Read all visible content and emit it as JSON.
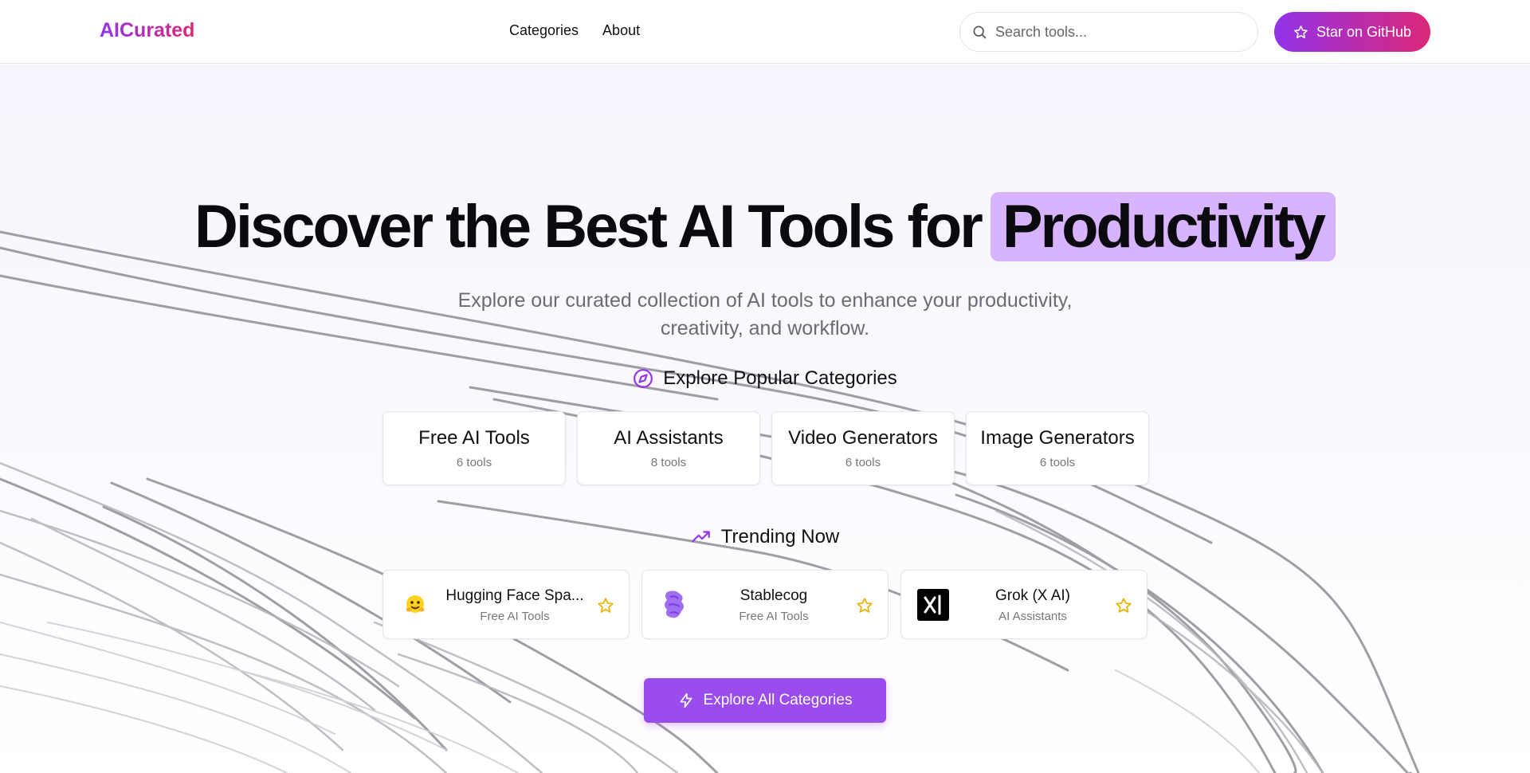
{
  "brand": {
    "logo_text": "AICurated",
    "gradient_from": "#9333ea",
    "gradient_to": "#db2777"
  },
  "nav": {
    "items": [
      {
        "label": "Categories"
      },
      {
        "label": "About"
      }
    ]
  },
  "search": {
    "placeholder": "Search tools...",
    "value": "",
    "icon": "search-icon"
  },
  "github_button": {
    "label": "Star on GitHub",
    "icon": "star-icon"
  },
  "hero": {
    "title": "Discover the Best AI Tools for",
    "highlight": "Productivity",
    "highlight_color": "#d8b4fe",
    "subtitle_line1": "Explore our curated collection of AI tools to enhance your productivity,",
    "subtitle_line2": "creativity, and workflow."
  },
  "categories_section": {
    "heading": "Explore Popular Categories",
    "icon": "compass-icon",
    "items": [
      {
        "name": "Free AI Tools",
        "count": "6 tools"
      },
      {
        "name": "AI Assistants",
        "count": "8 tools"
      },
      {
        "name": "Video Generators",
        "count": "6 tools"
      },
      {
        "name": "Image Generators",
        "count": "6 tools"
      }
    ]
  },
  "trending_section": {
    "heading": "Trending Now",
    "icon": "trending-up-icon",
    "items": [
      {
        "name": "Hugging Face Spa...",
        "category": "Free AI Tools",
        "logo": "hugging-face-logo"
      },
      {
        "name": "Stablecog",
        "category": "Free AI Tools",
        "logo": "stablecog-logo"
      },
      {
        "name": "Grok (X AI)",
        "category": "AI Assistants",
        "logo": "grok-logo"
      }
    ]
  },
  "explore_button": {
    "label": "Explore All Categories",
    "icon": "lightning-icon",
    "color": "#9a4ced"
  },
  "colors": {
    "accent": "#9333ea",
    "star": "#eab308"
  }
}
